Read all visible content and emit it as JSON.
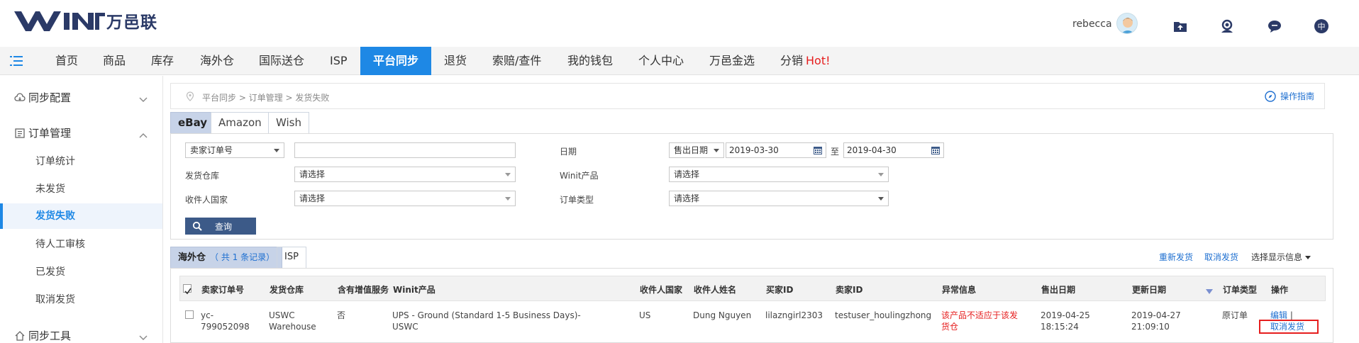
{
  "header": {
    "logo_text": "万邑联",
    "username": "rebecca"
  },
  "nav": {
    "items": [
      "首页",
      "商品",
      "库存",
      "海外仓",
      "国际送仓",
      "ISP",
      "平台同步",
      "退货",
      "索赔/查件",
      "我的钱包",
      "个人中心",
      "万邑金选",
      "分销"
    ],
    "hot": "Hot!"
  },
  "sidebar": {
    "group1": "同步配置",
    "group2": "订单管理",
    "items": [
      "订单统计",
      "未发货",
      "发货失败",
      "待人工审核",
      "已发货",
      "取消发货"
    ],
    "group3": "同步工具"
  },
  "breadcrumb": "平台同步 > 订单管理 > 发货失败",
  "guide_label": "操作指南",
  "platform_tabs": [
    "eBay",
    "Amazon",
    "Wish"
  ],
  "filters": {
    "order_field_select": "卖家订单号",
    "order_input": "",
    "warehouse_label": "发货仓库",
    "warehouse_value": "请选择",
    "country_label": "收件人国家",
    "country_value": "请选择",
    "date_label": "日期",
    "date_type": "售出日期",
    "date_from": "2019-03-30",
    "date_to_label": "至",
    "date_to": "2019-04-30",
    "product_label": "Winit产品",
    "product_value": "请选择",
    "order_type_label": "订单类型",
    "order_type_value": "请选择",
    "search_button": "查询"
  },
  "result_tabs": {
    "overseas": "海外仓",
    "overseas_count": "（ 共 1 条记录）",
    "isp": "ISP"
  },
  "actions": {
    "resend": "重新发货",
    "cancel": "取消发货",
    "display_info": "选择显示信息"
  },
  "table": {
    "headers": [
      "卖家订单号",
      "发货仓库",
      "含有增值服务",
      "Winit产品",
      "收件人国家",
      "收件人姓名",
      "买家ID",
      "卖家ID",
      "异常信息",
      "售出日期",
      "更新日期",
      "订单类型",
      "操作"
    ],
    "row": {
      "order_no_1": "yc-",
      "order_no_2": "799052098",
      "warehouse_1": "USWC",
      "warehouse_2": "Warehouse",
      "value_added": "否",
      "product_1": "UPS - Ground (Standard 1-5 Business Days)-",
      "product_2": "USWC",
      "country": "US",
      "recipient": "Dung Nguyen",
      "buyer_id": "lilazngirl2303",
      "seller_id": "testuser_houlingzhong",
      "error_1": "该产品不适应于该发",
      "error_2": "货仓",
      "sold_date_1": "2019-04-25",
      "sold_time": "18:15:24",
      "update_date_1": "2019-04-27",
      "update_time": "21:09:10",
      "order_type": "原订单",
      "op_edit": "编辑",
      "op_sep": "|",
      "op_cancel": "取消发货"
    }
  },
  "colors": {
    "primary": "#1e88e5",
    "link": "#1e6fd0",
    "error": "#e61e1e",
    "search_button": "#3c5a88",
    "active_tab": "#c7d3e8"
  }
}
